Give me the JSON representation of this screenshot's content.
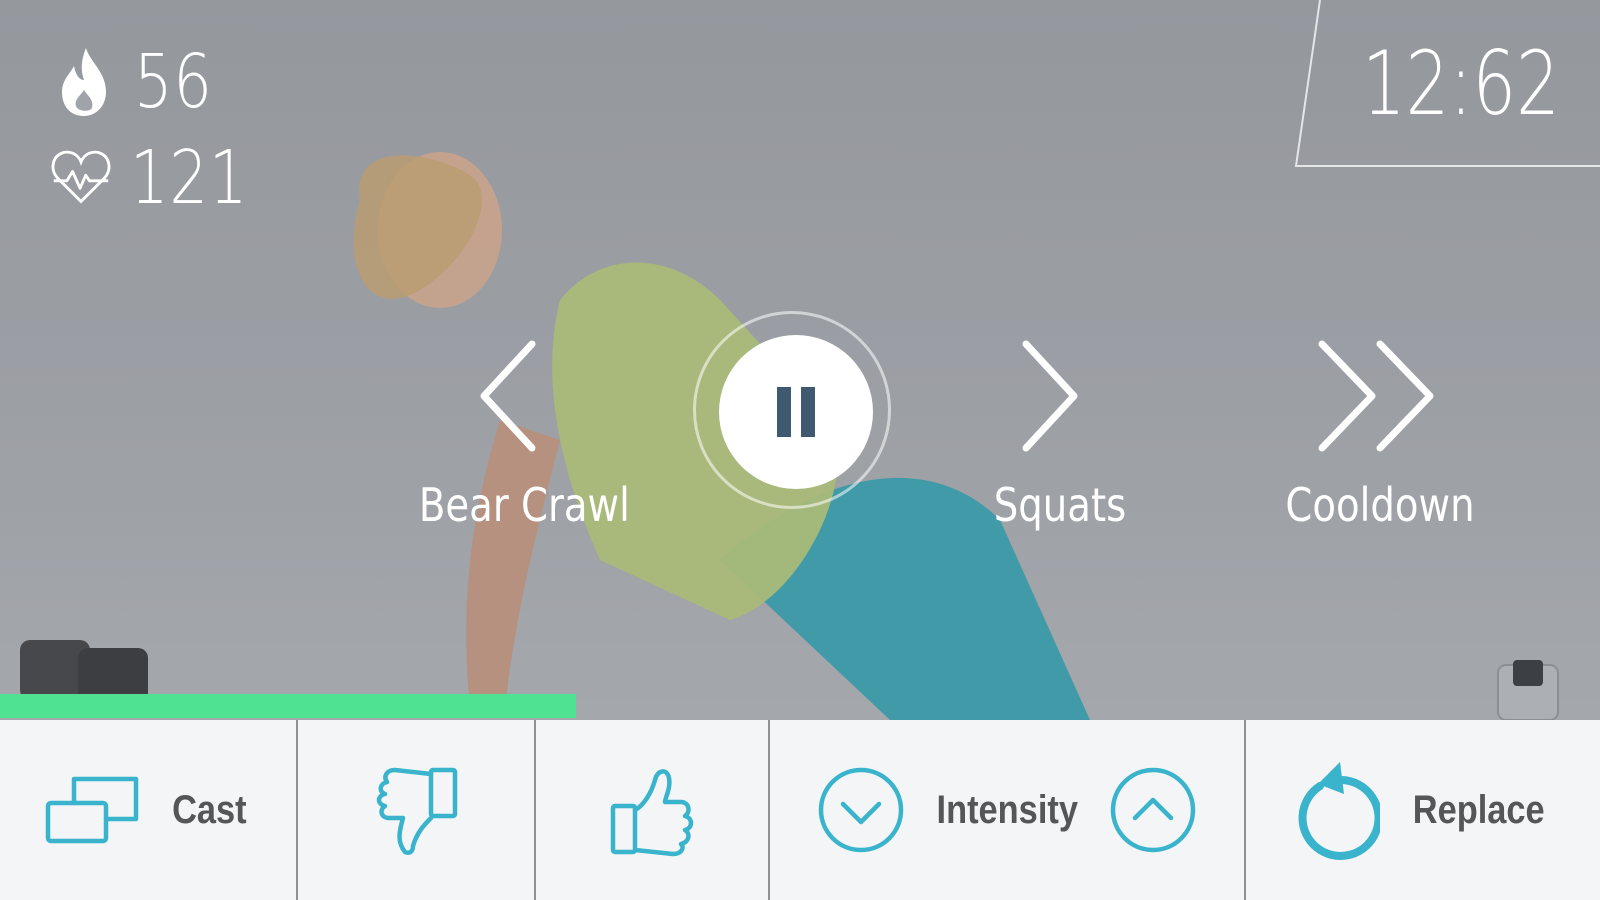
{
  "stats": {
    "calories_icon": "flame-icon",
    "calories": "56",
    "heart_icon": "heart-rate-icon",
    "heart_rate": "121"
  },
  "timer": "12:62",
  "controls": {
    "previous_label": "Bear Crawl",
    "next_label": "Squats",
    "skip_label": "Cooldown",
    "pause_icon": "pause-icon"
  },
  "progress": {
    "fraction": 0.36,
    "color": "#4fe292"
  },
  "toolbar": {
    "cast_label": "Cast",
    "dislike_icon": "thumbs-down-icon",
    "like_icon": "thumbs-up-icon",
    "intensity_label": "Intensity",
    "replace_label": "Replace"
  },
  "colors": {
    "accent": "#3ab3cc",
    "toolbar_text": "#545658"
  }
}
